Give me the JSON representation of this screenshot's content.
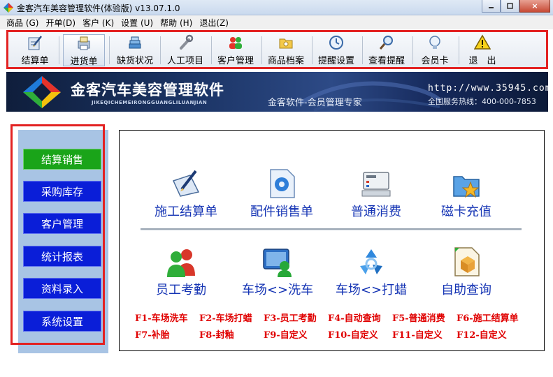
{
  "window": {
    "title": "金客汽车美容管理软件(体验版) v13.07.1.0",
    "close_glyph": "×"
  },
  "menu": [
    "商品 (G)",
    "开单(D)",
    "客户 (K)",
    "设置 (U)",
    "帮助 (H)",
    "退出(Z)"
  ],
  "toolbar": {
    "settlement": "结算单",
    "purchase": "进货单",
    "shortage": "缺货状况",
    "labor": "人工项目",
    "customers": "客户管理",
    "products": "商品档案",
    "reminder_setup": "提醒设置",
    "view_reminders": "查看提醒",
    "member_card": "会员卡",
    "exit": "退　出"
  },
  "banner": {
    "brand": "金客汽车美容管理软件",
    "pinyin": "JIKEQICHEMEIRONGGUANGLILUANJIAN",
    "slogan": "金客软件-会员管理专家",
    "url": "http://www.35945.com",
    "hotline": "全国服务热线：400-000-7853"
  },
  "sidebar": {
    "items": [
      "结算销售",
      "采购库存",
      "客户管理",
      "统计报表",
      "资料录入",
      "系统设置"
    ],
    "active_index": 0
  },
  "main": {
    "row1": [
      "施工结算单",
      "配件销售单",
      "普通消费",
      "磁卡充值"
    ],
    "row2": [
      "员工考勤",
      "车场<>洗车",
      "车场<>打蜡",
      "自助查询"
    ],
    "hotkeys_row1": [
      "F1-车场洗车",
      "F2-车场打蜡",
      "F3-员工考勤",
      "F4-自动查询",
      "F5-普通消费",
      "F6-施工结算单"
    ],
    "hotkeys_row2": [
      "F7-补胎",
      "F8-封釉",
      "F9-自定义",
      "F10-自定义",
      "F11-自定义",
      "F12-自定义"
    ]
  },
  "colors": {
    "highlight_border": "#e32222",
    "sidebar_bg": "#a8c4e4",
    "sidebar_button": "#0a1ed8",
    "sidebar_button_active": "#1aa419",
    "function_label": "#1534b4",
    "hotkey_text": "#e00000"
  }
}
